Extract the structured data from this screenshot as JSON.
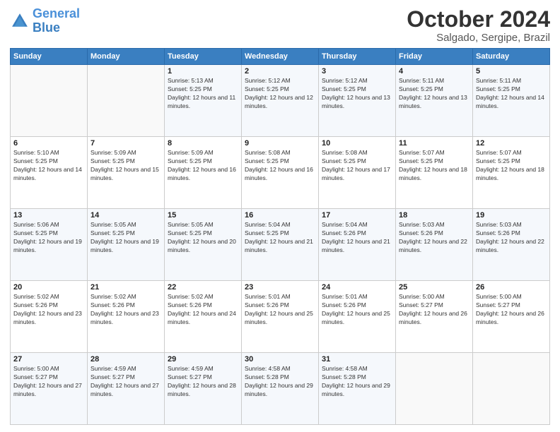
{
  "logo": {
    "line1": "General",
    "line2": "Blue"
  },
  "title": "October 2024",
  "subtitle": "Salgado, Sergipe, Brazil",
  "weekdays": [
    "Sunday",
    "Monday",
    "Tuesday",
    "Wednesday",
    "Thursday",
    "Friday",
    "Saturday"
  ],
  "weeks": [
    [
      {
        "day": "",
        "info": ""
      },
      {
        "day": "",
        "info": ""
      },
      {
        "day": "1",
        "info": "Sunrise: 5:13 AM\nSunset: 5:25 PM\nDaylight: 12 hours and 11 minutes."
      },
      {
        "day": "2",
        "info": "Sunrise: 5:12 AM\nSunset: 5:25 PM\nDaylight: 12 hours and 12 minutes."
      },
      {
        "day": "3",
        "info": "Sunrise: 5:12 AM\nSunset: 5:25 PM\nDaylight: 12 hours and 13 minutes."
      },
      {
        "day": "4",
        "info": "Sunrise: 5:11 AM\nSunset: 5:25 PM\nDaylight: 12 hours and 13 minutes."
      },
      {
        "day": "5",
        "info": "Sunrise: 5:11 AM\nSunset: 5:25 PM\nDaylight: 12 hours and 14 minutes."
      }
    ],
    [
      {
        "day": "6",
        "info": "Sunrise: 5:10 AM\nSunset: 5:25 PM\nDaylight: 12 hours and 14 minutes."
      },
      {
        "day": "7",
        "info": "Sunrise: 5:09 AM\nSunset: 5:25 PM\nDaylight: 12 hours and 15 minutes."
      },
      {
        "day": "8",
        "info": "Sunrise: 5:09 AM\nSunset: 5:25 PM\nDaylight: 12 hours and 16 minutes."
      },
      {
        "day": "9",
        "info": "Sunrise: 5:08 AM\nSunset: 5:25 PM\nDaylight: 12 hours and 16 minutes."
      },
      {
        "day": "10",
        "info": "Sunrise: 5:08 AM\nSunset: 5:25 PM\nDaylight: 12 hours and 17 minutes."
      },
      {
        "day": "11",
        "info": "Sunrise: 5:07 AM\nSunset: 5:25 PM\nDaylight: 12 hours and 18 minutes."
      },
      {
        "day": "12",
        "info": "Sunrise: 5:07 AM\nSunset: 5:25 PM\nDaylight: 12 hours and 18 minutes."
      }
    ],
    [
      {
        "day": "13",
        "info": "Sunrise: 5:06 AM\nSunset: 5:25 PM\nDaylight: 12 hours and 19 minutes."
      },
      {
        "day": "14",
        "info": "Sunrise: 5:05 AM\nSunset: 5:25 PM\nDaylight: 12 hours and 19 minutes."
      },
      {
        "day": "15",
        "info": "Sunrise: 5:05 AM\nSunset: 5:25 PM\nDaylight: 12 hours and 20 minutes."
      },
      {
        "day": "16",
        "info": "Sunrise: 5:04 AM\nSunset: 5:25 PM\nDaylight: 12 hours and 21 minutes."
      },
      {
        "day": "17",
        "info": "Sunrise: 5:04 AM\nSunset: 5:26 PM\nDaylight: 12 hours and 21 minutes."
      },
      {
        "day": "18",
        "info": "Sunrise: 5:03 AM\nSunset: 5:26 PM\nDaylight: 12 hours and 22 minutes."
      },
      {
        "day": "19",
        "info": "Sunrise: 5:03 AM\nSunset: 5:26 PM\nDaylight: 12 hours and 22 minutes."
      }
    ],
    [
      {
        "day": "20",
        "info": "Sunrise: 5:02 AM\nSunset: 5:26 PM\nDaylight: 12 hours and 23 minutes."
      },
      {
        "day": "21",
        "info": "Sunrise: 5:02 AM\nSunset: 5:26 PM\nDaylight: 12 hours and 23 minutes."
      },
      {
        "day": "22",
        "info": "Sunrise: 5:02 AM\nSunset: 5:26 PM\nDaylight: 12 hours and 24 minutes."
      },
      {
        "day": "23",
        "info": "Sunrise: 5:01 AM\nSunset: 5:26 PM\nDaylight: 12 hours and 25 minutes."
      },
      {
        "day": "24",
        "info": "Sunrise: 5:01 AM\nSunset: 5:26 PM\nDaylight: 12 hours and 25 minutes."
      },
      {
        "day": "25",
        "info": "Sunrise: 5:00 AM\nSunset: 5:27 PM\nDaylight: 12 hours and 26 minutes."
      },
      {
        "day": "26",
        "info": "Sunrise: 5:00 AM\nSunset: 5:27 PM\nDaylight: 12 hours and 26 minutes."
      }
    ],
    [
      {
        "day": "27",
        "info": "Sunrise: 5:00 AM\nSunset: 5:27 PM\nDaylight: 12 hours and 27 minutes."
      },
      {
        "day": "28",
        "info": "Sunrise: 4:59 AM\nSunset: 5:27 PM\nDaylight: 12 hours and 27 minutes."
      },
      {
        "day": "29",
        "info": "Sunrise: 4:59 AM\nSunset: 5:27 PM\nDaylight: 12 hours and 28 minutes."
      },
      {
        "day": "30",
        "info": "Sunrise: 4:58 AM\nSunset: 5:28 PM\nDaylight: 12 hours and 29 minutes."
      },
      {
        "day": "31",
        "info": "Sunrise: 4:58 AM\nSunset: 5:28 PM\nDaylight: 12 hours and 29 minutes."
      },
      {
        "day": "",
        "info": ""
      },
      {
        "day": "",
        "info": ""
      }
    ]
  ]
}
